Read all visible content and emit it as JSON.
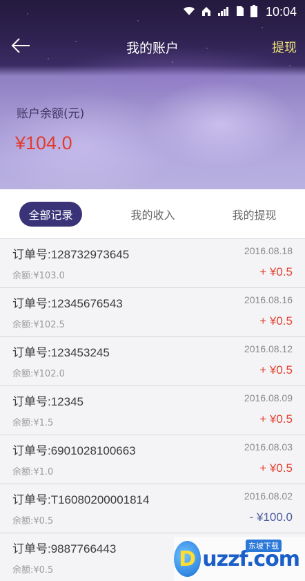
{
  "status_bar": {
    "time": "10:04",
    "icons": [
      "wifi-icon",
      "home-icon",
      "signal-icon",
      "sim-icon",
      "battery-icon"
    ]
  },
  "nav": {
    "title": "我的账户",
    "withdraw_label": "提现",
    "back_icon": "back-arrow-icon"
  },
  "balance": {
    "label": "账户余额(元)",
    "amount": "¥104.0"
  },
  "tabs": [
    {
      "label": "全部记录",
      "active": true
    },
    {
      "label": "我的收入",
      "active": false
    },
    {
      "label": "我的提现",
      "active": false
    }
  ],
  "records": [
    {
      "order": "订单号:128732973645",
      "date": "2016.08.18",
      "balance": "余额:¥103.0",
      "amount": "+ ¥0.5",
      "type": "plus"
    },
    {
      "order": "订单号:12345676543",
      "date": "2016.08.16",
      "balance": "余额:¥102.5",
      "amount": "+ ¥0.5",
      "type": "plus"
    },
    {
      "order": "订单号:123453245",
      "date": "2016.08.12",
      "balance": "余额:¥102.0",
      "amount": "+ ¥0.5",
      "type": "plus"
    },
    {
      "order": "订单号:12345",
      "date": "2016.08.09",
      "balance": "余额:¥1.5",
      "amount": "+ ¥0.5",
      "type": "plus"
    },
    {
      "order": "订单号:6901028100663",
      "date": "2016.08.03",
      "balance": "余额:¥1.0",
      "amount": "+ ¥0.5",
      "type": "plus"
    },
    {
      "order": "订单号:T16080200001814",
      "date": "2016.08.02",
      "balance": "余额:¥0.5",
      "amount": "- ¥100.0",
      "type": "minus"
    },
    {
      "order": "订单号:9887766443",
      "date": "",
      "balance": "余额:¥0.5",
      "amount": "",
      "type": "plus"
    }
  ],
  "watermark": {
    "text": "uzzf.com",
    "sub": "东坡下载"
  },
  "colors": {
    "accent_tab": "#3a3377",
    "amount_positive": "#e2412f",
    "amount_negative": "#4a5a9a",
    "withdraw_link": "#f3e37a"
  }
}
